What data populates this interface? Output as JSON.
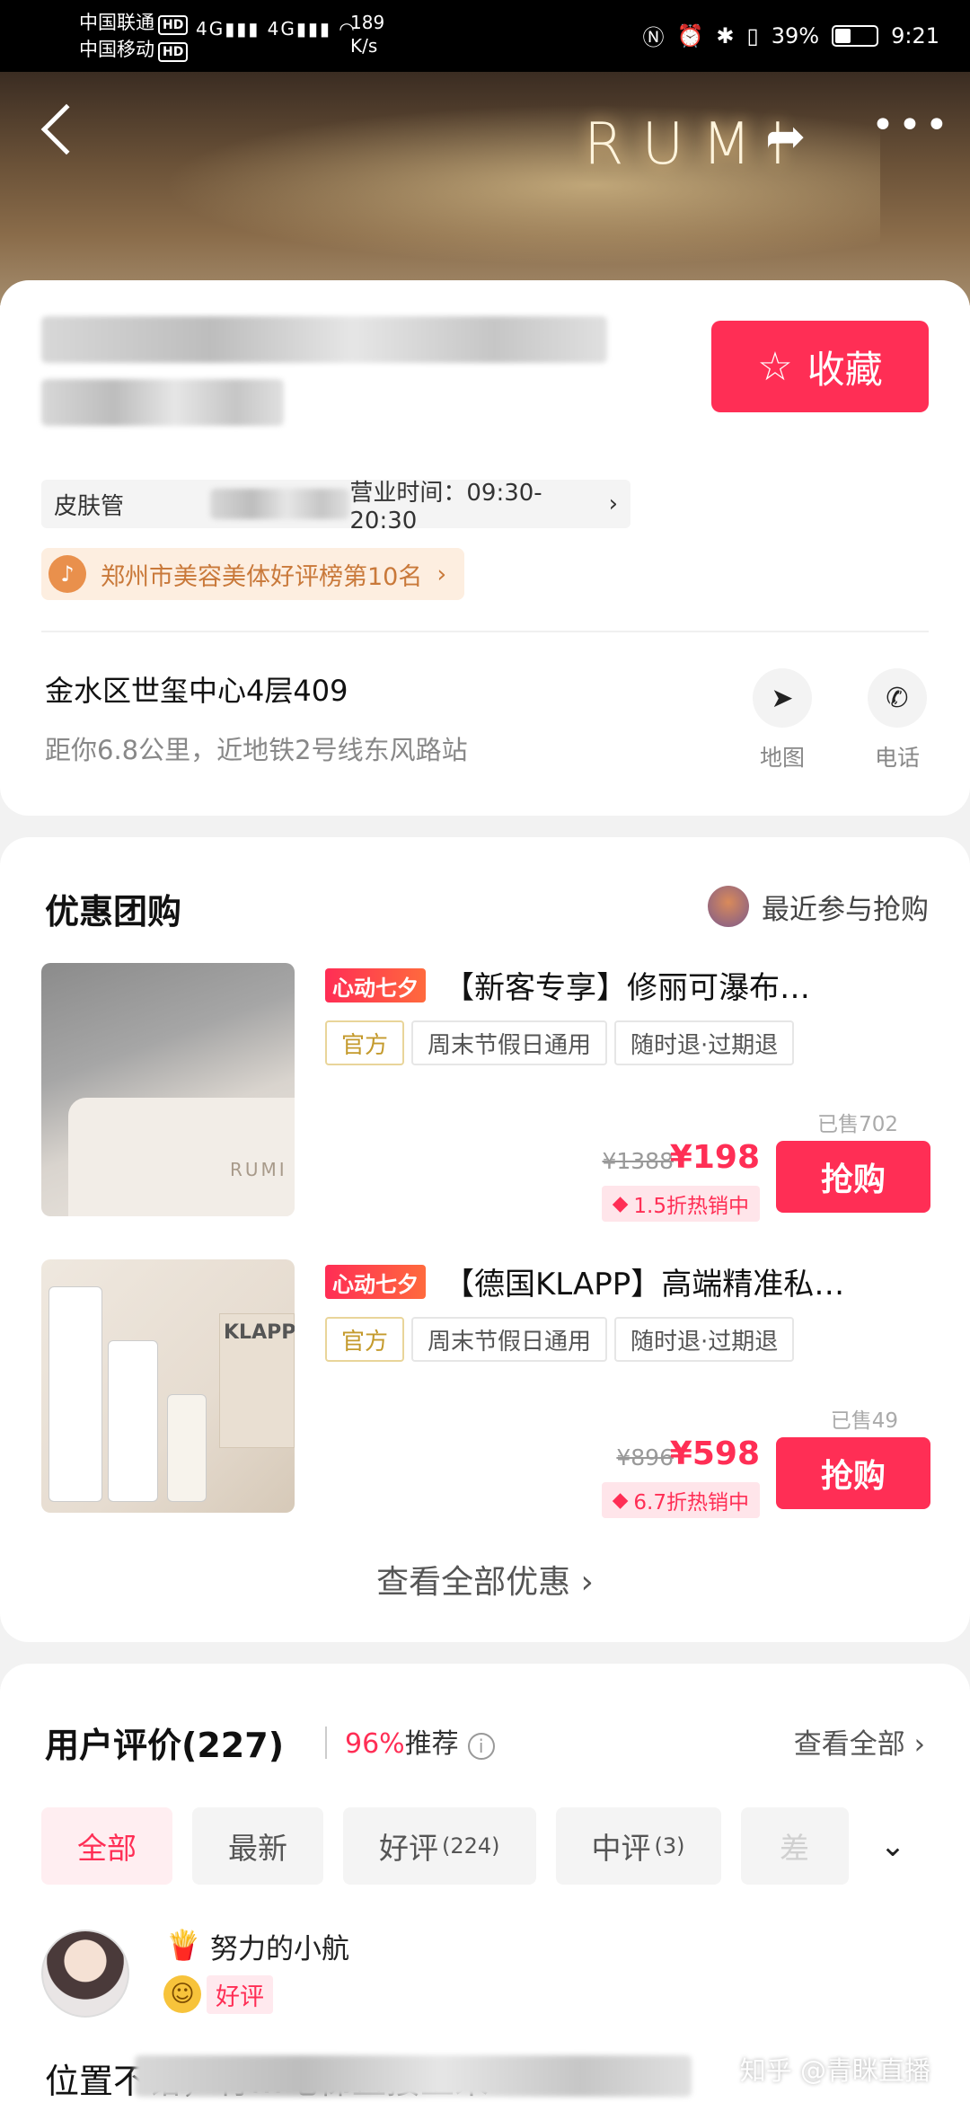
{
  "status_bar": {
    "carrier1": "中国联通",
    "carrier2": "中国移动",
    "hd": "HD",
    "signal1": "4G",
    "signal2": "4G",
    "speed_value": "189",
    "speed_unit": "K/s",
    "battery": "39%",
    "time": "9:21"
  },
  "hero": {
    "brand_text": "RUMI"
  },
  "shop": {
    "favorite_label": "收藏",
    "category_visible": "皮肤管",
    "hours": "营业时间：09:30-20:30",
    "rank": "郑州市美容美体好评榜第10名",
    "address": "金水区世玺中心4层409",
    "distance": "距你6.8公里，近地铁2号线东风路站",
    "map_label": "地图",
    "phone_label": "电话"
  },
  "deals": {
    "title": "优惠团购",
    "recent_label": "最近参与抢购",
    "view_all": "查看全部优惠",
    "items": [
      {
        "badge": "心动七夕",
        "name": "【新客专享】修丽可瀑布…",
        "tags": [
          "官方",
          "周末节假日通用",
          "随时退·过期退"
        ],
        "sold": "已售702",
        "original_price": "¥1388",
        "price": "¥198",
        "discount": "1.5折热销中",
        "buy_label": "抢购"
      },
      {
        "badge": "心动七夕",
        "name": "【德国KLAPP】高端精准私…",
        "tags": [
          "官方",
          "周末节假日通用",
          "随时退·过期退"
        ],
        "sold": "已售49",
        "original_price": "¥896",
        "price": "¥598",
        "discount": "6.7折热销中",
        "buy_label": "抢购",
        "thumb_brand": "KLAPP"
      }
    ]
  },
  "reviews": {
    "title": "用户评价(227)",
    "recommend_pct": "96%",
    "recommend_label": "推荐",
    "view_all": "查看全部",
    "filters": [
      {
        "label": "全部",
        "count": ""
      },
      {
        "label": "最新",
        "count": ""
      },
      {
        "label": "好评",
        "count": "(224)"
      },
      {
        "label": "中评",
        "count": "(3)"
      },
      {
        "label": "差",
        "count": ""
      }
    ],
    "reviewer": {
      "name": "努力的小航",
      "rating": "好评",
      "text": "位置不错，有…电梯直接上来"
    }
  },
  "watermark": "知乎 @青眯直播"
}
